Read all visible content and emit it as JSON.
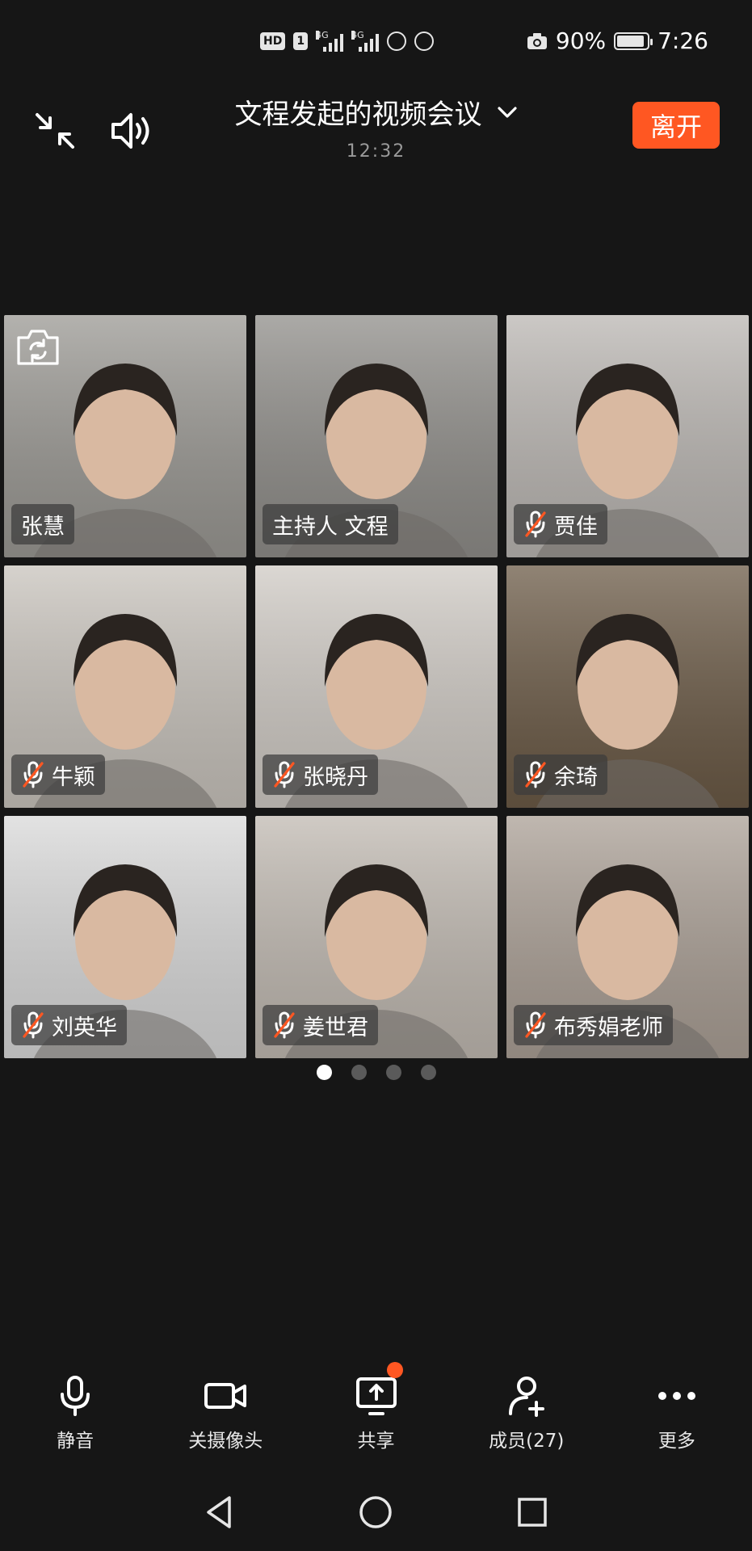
{
  "status_bar": {
    "hd_badge": "HD",
    "sim1": "1",
    "net1": "4G",
    "net2": "4G",
    "battery_percent_text": "90%",
    "battery_level": 0.9,
    "time": "7:26"
  },
  "header": {
    "title": "文程发起的视频会议",
    "duration": "12:32",
    "leave_label": "离开"
  },
  "participants": [
    {
      "name": "张慧",
      "muted": false,
      "bg": "#9a9893"
    },
    {
      "name": "主持人  文程",
      "muted": false,
      "bg": "#8f8d89"
    },
    {
      "name": "贾佳",
      "muted": true,
      "bg": "#bab6b2"
    },
    {
      "name": "牛颖",
      "muted": true,
      "bg": "#c8c3bc"
    },
    {
      "name": "张晓丹",
      "muted": true,
      "bg": "#cfcac4"
    },
    {
      "name": "余琦",
      "muted": true,
      "bg": "#6b5a46"
    },
    {
      "name": "刘英华",
      "muted": true,
      "bg": "#d9d9d9"
    },
    {
      "name": "姜世君",
      "muted": true,
      "bg": "#c0b9b1"
    },
    {
      "name": "布秀娟老师",
      "muted": true,
      "bg": "#aa9f95"
    }
  ],
  "pagination": {
    "pages": 4,
    "current": 1
  },
  "toolbar": {
    "mute": "静音",
    "camera": "关摄像头",
    "share": "共享",
    "members": "成员(27)",
    "more": "更多"
  },
  "colors": {
    "accent": "#ff5722",
    "background": "#161616"
  }
}
